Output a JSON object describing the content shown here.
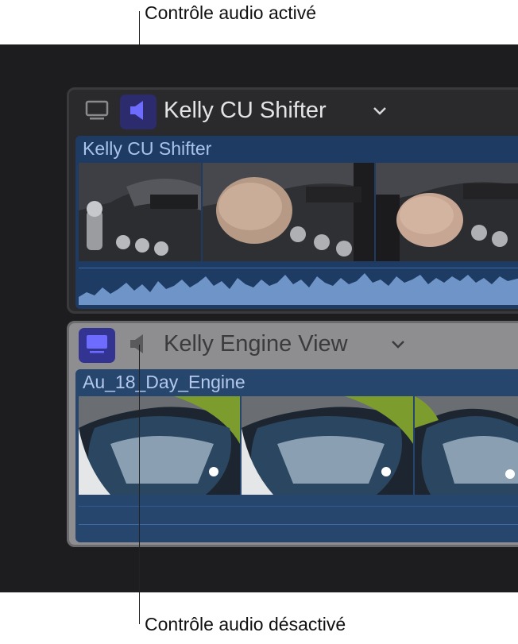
{
  "callouts": {
    "top": "Contrôle audio activé",
    "bottom": "Contrôle audio désactivé"
  },
  "angles": [
    {
      "name": "Kelly CU Shifter",
      "video_enabled": false,
      "audio_enabled": true,
      "clip_name": "Kelly CU Shifter"
    },
    {
      "name": "Kelly Engine View",
      "video_enabled": true,
      "audio_enabled": false,
      "clip_name": "Au_18_Day_Engine"
    }
  ],
  "icons": {
    "video": "monitor-icon",
    "audio": "speaker-icon",
    "menu": "chevron-down-icon"
  },
  "colors": {
    "timeline_bg": "#1d1d1f",
    "enabled_button_bg": "#2b2b6e",
    "enabled_icon": "#6e6cff",
    "clip_blue": "#1e3b63",
    "waveform": "#6f95c8"
  }
}
